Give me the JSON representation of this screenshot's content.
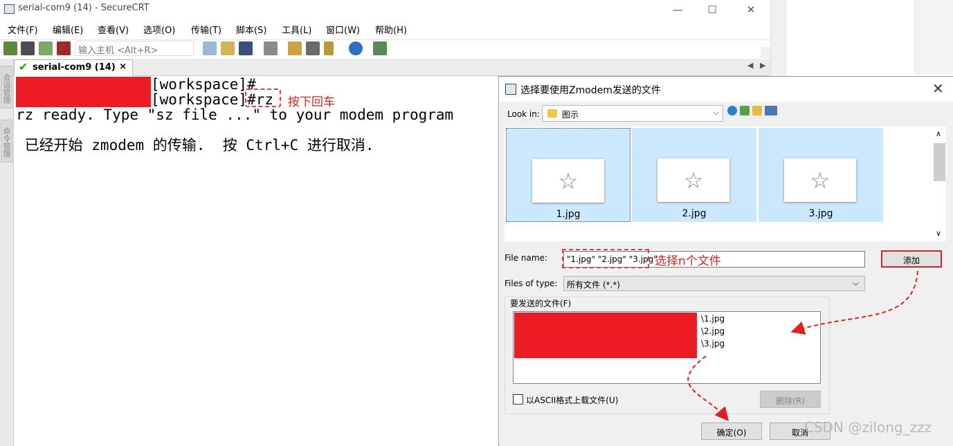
{
  "window": {
    "title": "serial-com9 (14) - SecureCRT",
    "minimize": "—",
    "maximize": "☐",
    "close": "✕"
  },
  "menu": [
    "文件(F)",
    "编辑(E)",
    "查看(V)",
    "选项(O)",
    "传输(T)",
    "脚本(S)",
    "工具(L)",
    "窗口(W)",
    "帮助(H)"
  ],
  "toolbar": {
    "host_placeholder": "输入主机 <Alt+R>"
  },
  "tab": {
    "label": "serial-com9 (14)",
    "close": "×"
  },
  "sidebar": {
    "session_manager": "会话管理",
    "command_manager": "命令管理"
  },
  "terminal": {
    "line1": "[workspace]#",
    "line2": "[workspace]#rz",
    "line3": "rz ready. Type \"sz file ...\" to your modem program",
    "line4": " 已经开始 zmodem 的传输.  按 Ctrl+C 进行取消."
  },
  "annotations": {
    "press_enter": "按下回车",
    "select_files": "选择n个文件"
  },
  "dialog": {
    "title": "选择要使用Zmodem发送的文件",
    "lookin_label": "Look in:",
    "lookin_value": "图示",
    "files": [
      "1.jpg",
      "2.jpg",
      "3.jpg"
    ],
    "filename_label": "File name:",
    "filename_value": "\"1.jpg\" \"2.jpg\" \"3.jpg\"",
    "filetype_label": "Files of type:",
    "filetype_value": "所有文件 (*.*)",
    "add_button": "添加",
    "send_group_label": "要发送的文件(F)",
    "send_files": [
      "\\1.jpg",
      "\\2.jpg",
      "\\3.jpg"
    ],
    "ascii_label": "以ASCII格式上载文件(U)",
    "delete_button": "删除(R)",
    "ok_button": "确定(O)",
    "cancel_button": "取消"
  },
  "watermark": "CSDN @zilong_zzz",
  "colors": {
    "annotation": "#e02020",
    "redaction": "#ed1c24",
    "selection": "#cce8ff"
  }
}
